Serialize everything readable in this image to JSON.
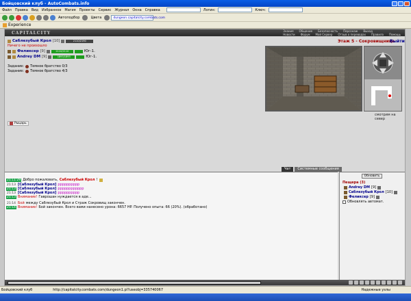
{
  "window": {
    "title": "Бойцовский клуб - AutoCombats.info"
  },
  "menu": [
    "Файл",
    "Правка",
    "Вид",
    "Избранное",
    "Магия",
    "Проекты",
    "Сервис",
    "Журнал",
    "Окна",
    "Справка"
  ],
  "menu_right": {
    "label1": "Логин:",
    "label2": "Ключ:"
  },
  "toolbar": {
    "autofill": "Автоподбор",
    "colors": "Цвета",
    "address": "dungeon.capitalcity.combats.com"
  },
  "links": {
    "experience": "Experience"
  },
  "game": {
    "logo": "CAPITALCITY",
    "nav_top": [
      "Знания",
      "Общение",
      "Безопасность",
      "Персонаж",
      "Выход"
    ],
    "nav_bottom": [
      "Новости",
      "Форум",
      "Мой Сервер",
      "Отзыв о переводах",
      "Правила",
      "Помощь"
    ],
    "floor_title": "Этаж 5 - Сокровищница",
    "exit": "Выйти",
    "player": {
      "name": "Саблезубый Крол",
      "level": "[10]",
      "hp": "2110/2190"
    },
    "notice": "Ничего не произошло",
    "party": [
      {
        "name": "Феликсер",
        "level": "[9]",
        "hp": "2110/2110",
        "dir": "Юг-1."
      },
      {
        "name": "Andrey DM",
        "level": "[9]",
        "hp": "1893/1893",
        "dir": "Юг-1."
      }
    ],
    "quests": [
      {
        "label": "Задание:",
        "text": "Темное братство 0/3"
      },
      {
        "label": "Задание:",
        "text": "Темное братство 4/3"
      }
    ],
    "looking": "смотрим на север",
    "party_chip": "Рыцарь",
    "tabs": [
      "Чат",
      "Системные сообщения"
    ],
    "chat": [
      {
        "time": "21:11:29",
        "parts": [
          "Добро пожаловать,",
          "Саблезубый Крол",
          "!"
        ]
      },
      {
        "time": "21:13",
        "speaker": "[Саблезубый Крол]",
        "text": "рррррррррр"
      },
      {
        "time": "21:13",
        "speaker": "[Саблезубый Крол]",
        "text": "рррррррррррр"
      },
      {
        "time": "21:13",
        "speaker": "[Саблезубый Крол]",
        "text": "рррррррррр"
      },
      {
        "time": "21:13",
        "label": "Внимание!",
        "text": "Гаврошан нуждается в аде..."
      },
      {
        "time": "21:14",
        "label": "Бой",
        "text": "между Саблезубый Крол и Страж Сокровищ закончен."
      },
      {
        "time": "21:14",
        "label": "Внимание!",
        "text": "Бой закончен. Всего вами нанесено урона: 6657 HP. Получено опыта: 66 (20%). (обработано)"
      }
    ],
    "right": {
      "refresh": "Обновить",
      "cave_title": "Пещера (3)",
      "roster": [
        {
          "name": "Andrey DM",
          "level": "[9]"
        },
        {
          "name": "Саблезубый Крол",
          "level": "[10]"
        },
        {
          "name": "Феликсер",
          "level": "[9]"
        }
      ],
      "auto": "Обновлять автомат."
    }
  },
  "status": {
    "left": "Бойцовский клуб",
    "url": "http://capitalcity.combats.com/dungeon1.pl?useobj=335740067",
    "zone": "Надежные узлы"
  }
}
